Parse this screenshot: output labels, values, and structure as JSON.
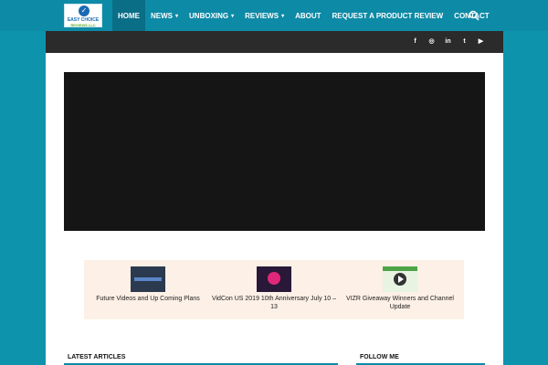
{
  "header": {
    "logo_text": "EASY CHOICE",
    "logo_sub": "REVIEWS LLC",
    "nav": [
      {
        "label": "Home",
        "dropdown": false,
        "active": true
      },
      {
        "label": "News",
        "dropdown": true,
        "active": false
      },
      {
        "label": "Unboxing",
        "dropdown": true,
        "active": false
      },
      {
        "label": "Reviews",
        "dropdown": true,
        "active": false
      },
      {
        "label": "About",
        "dropdown": false,
        "active": false
      },
      {
        "label": "Request a Product Review",
        "dropdown": false,
        "active": false
      },
      {
        "label": "Contact",
        "dropdown": false,
        "active": false
      }
    ]
  },
  "social": {
    "facebook": "f",
    "instagram": "◎",
    "linkedin": "in",
    "twitter": "t",
    "youtube": "▶"
  },
  "playlist": [
    {
      "title": "Future Videos and Up Coming Plans"
    },
    {
      "title": "VidCon US 2019 10th Anniversary July 10 – 13"
    },
    {
      "title": "VIZR Giveaway Winners and Channel Update"
    }
  ],
  "sections": {
    "latest": "LATEST ARTICLES",
    "follow": "FOLLOW ME"
  },
  "colors": {
    "brand": "#0d8aa6",
    "bg": "#0e93ad",
    "dark": "#2b2b2b"
  }
}
